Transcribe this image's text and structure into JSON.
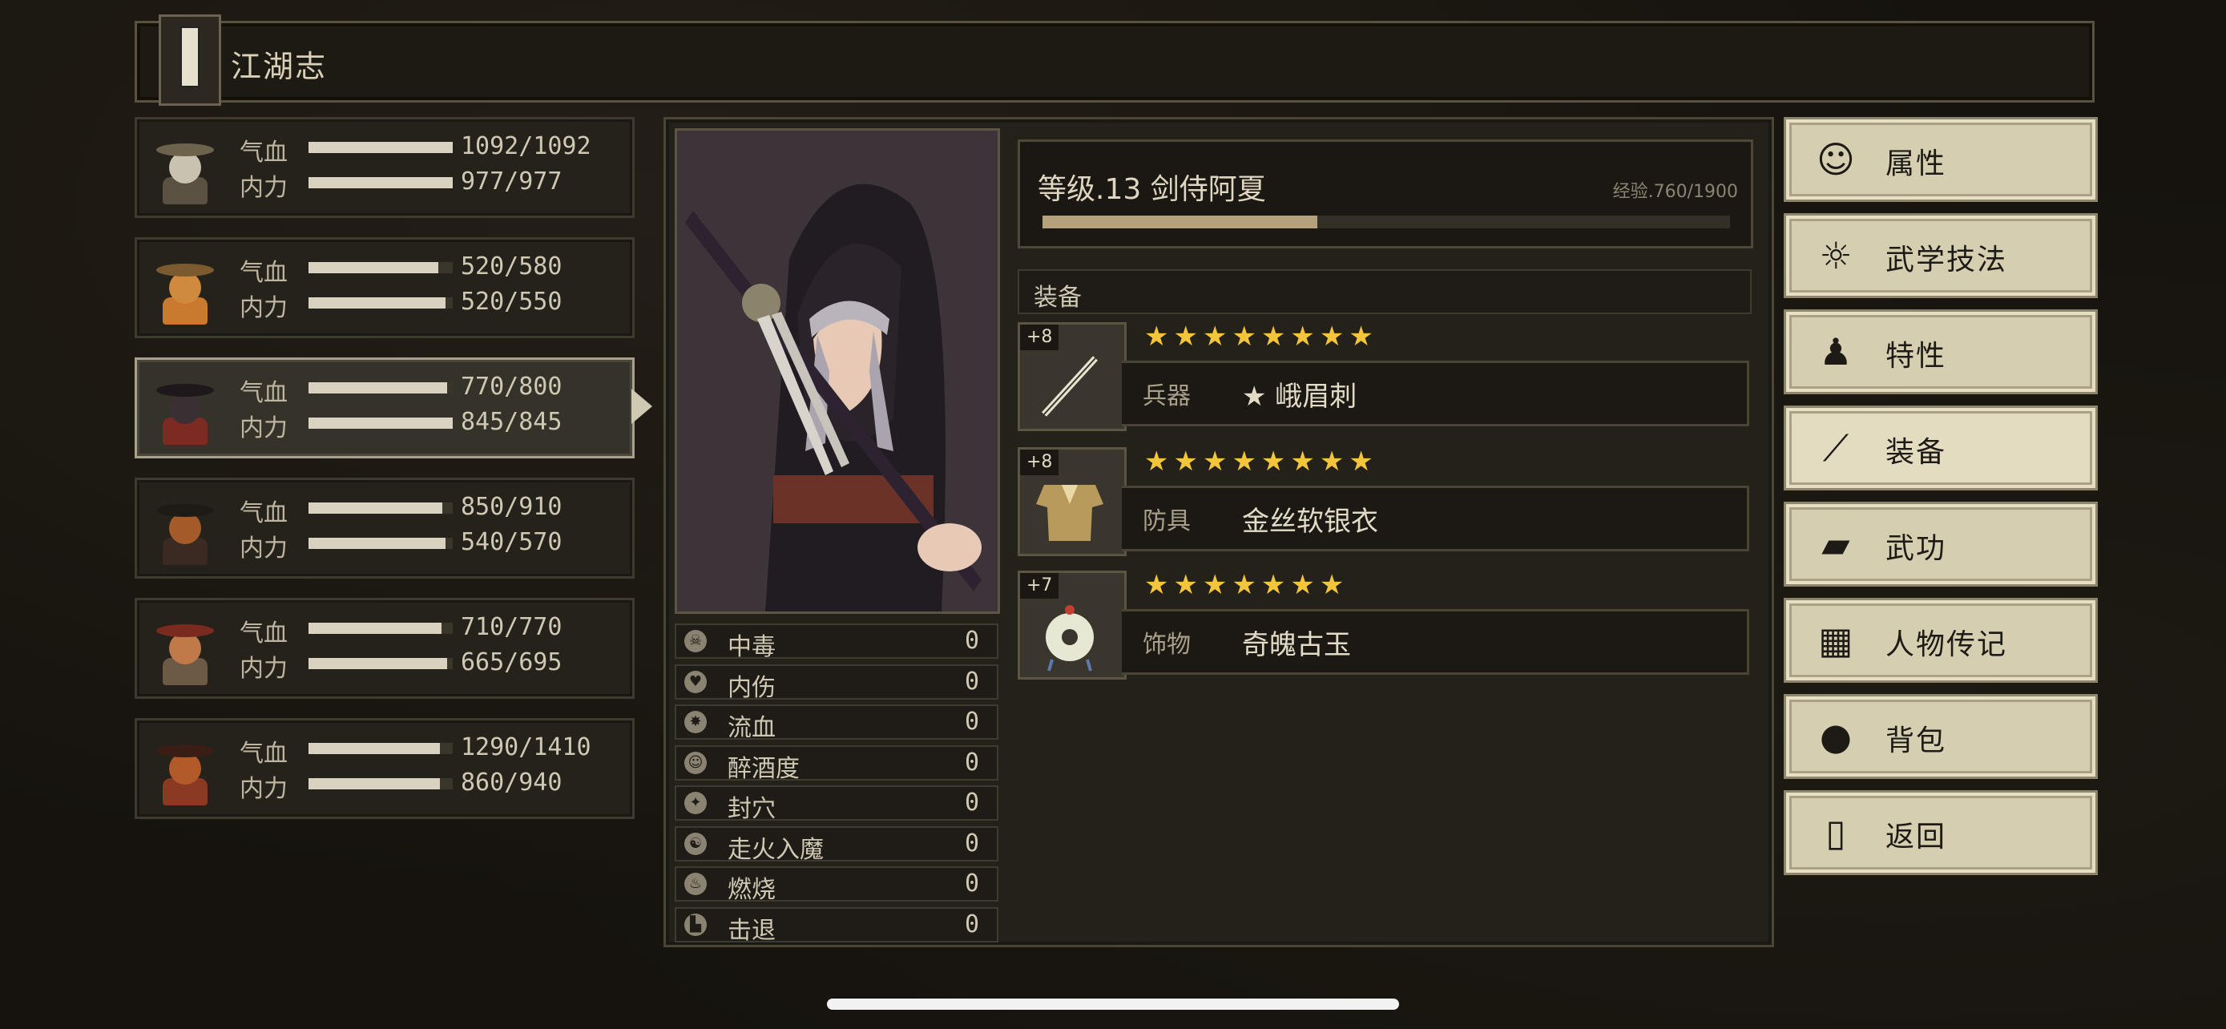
{
  "title": "江湖志",
  "party": [
    {
      "hp_label": "气血",
      "mp_label": "内力",
      "hp": "1092/1092",
      "mp": "977/977",
      "hp_frac": 1.0,
      "mp_frac": 1.0,
      "selected": false
    },
    {
      "hp_label": "气血",
      "mp_label": "内力",
      "hp": "520/580",
      "mp": "520/550",
      "hp_frac": 0.9,
      "mp_frac": 0.95,
      "selected": false
    },
    {
      "hp_label": "气血",
      "mp_label": "内力",
      "hp": "770/800",
      "mp": "845/845",
      "hp_frac": 0.96,
      "mp_frac": 1.0,
      "selected": true
    },
    {
      "hp_label": "气血",
      "mp_label": "内力",
      "hp": "850/910",
      "mp": "540/570",
      "hp_frac": 0.93,
      "mp_frac": 0.95,
      "selected": false
    },
    {
      "hp_label": "气血",
      "mp_label": "内力",
      "hp": "710/770",
      "mp": "665/695",
      "hp_frac": 0.92,
      "mp_frac": 0.96,
      "selected": false
    },
    {
      "hp_label": "气血",
      "mp_label": "内力",
      "hp": "1290/1410",
      "mp": "860/940",
      "hp_frac": 0.91,
      "mp_frac": 0.91,
      "selected": false
    }
  ],
  "character": {
    "level_title": "等级.13 剑侍阿夏",
    "exp_text": "经验.760/1900",
    "exp_frac": 0.4
  },
  "status_effects": [
    {
      "icon": "poison-icon",
      "label": "中毒",
      "value": "0"
    },
    {
      "icon": "broken-heart-icon",
      "label": "内伤",
      "value": "0"
    },
    {
      "icon": "bleed-icon",
      "label": "流血",
      "value": "0"
    },
    {
      "icon": "drunk-icon",
      "label": "醉酒度",
      "value": "0"
    },
    {
      "icon": "acupoint-icon",
      "label": "封穴",
      "value": "0"
    },
    {
      "icon": "qi-deviation-icon",
      "label": "走火入魔",
      "value": "0"
    },
    {
      "icon": "fire-icon",
      "label": "燃烧",
      "value": "0"
    },
    {
      "icon": "knockback-icon",
      "label": "击退",
      "value": "0"
    }
  ],
  "equipment": {
    "header": "装备",
    "items": [
      {
        "plus": "+8",
        "stars": "★★★★★★★★",
        "type": "兵器",
        "name": "★ 峨眉刺",
        "icon": "weapon-icon"
      },
      {
        "plus": "+8",
        "stars": "★★★★★★★★",
        "type": "防具",
        "name": "金丝软银衣",
        "icon": "armor-icon"
      },
      {
        "plus": "+7",
        "stars": "★★★★★★★",
        "type": "饰物",
        "name": "奇魄古玉",
        "icon": "jade-icon"
      }
    ]
  },
  "menu": [
    {
      "label": "属性",
      "icon": "person-icon",
      "active": false
    },
    {
      "label": "武学技法",
      "icon": "martial-arts-icon",
      "active": false
    },
    {
      "label": "特性",
      "icon": "trait-icon",
      "active": false
    },
    {
      "label": "装备",
      "icon": "sword-icon",
      "active": true
    },
    {
      "label": "武功",
      "icon": "book-icon",
      "active": false
    },
    {
      "label": "人物传记",
      "icon": "scroll-icon",
      "active": false
    },
    {
      "label": "背包",
      "icon": "bag-icon",
      "active": false
    },
    {
      "label": "返回",
      "icon": "door-icon",
      "active": false
    }
  ],
  "colors": {
    "accent_gold": "#f2c53a",
    "panel_bg": "#24211b",
    "menu_bg": "#d6ceb0"
  }
}
